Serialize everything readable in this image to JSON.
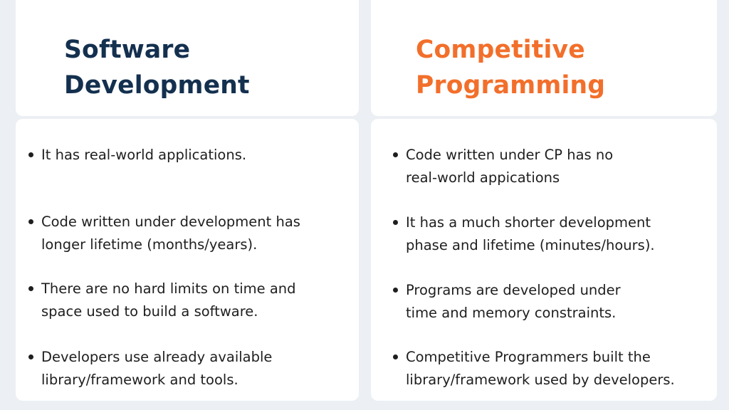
{
  "left": {
    "heading_line1": "Software",
    "heading_line2": "Development",
    "points": [
      "It has real-world applications.",
      "Code written under development has\nlonger lifetime (months/years).",
      "There are no hard limits on time and\nspace used to build a software.",
      "Developers use already available\nlibrary/framework and tools."
    ]
  },
  "right": {
    "heading_line1": "Competitive",
    "heading_line2": "Programming",
    "points": [
      "Code written under CP has no\nreal-world appications",
      "It has a much shorter development\nphase and lifetime (minutes/hours).",
      "Programs are developed under\ntime and memory constraints.",
      "Competitive Programmers built the\nlibrary/framework used by developers."
    ]
  },
  "colors": {
    "left_heading": "#14304f",
    "right_heading": "#f26f2b",
    "background": "#eceff3",
    "card": "#ffffff",
    "text": "#1e1e1e"
  }
}
